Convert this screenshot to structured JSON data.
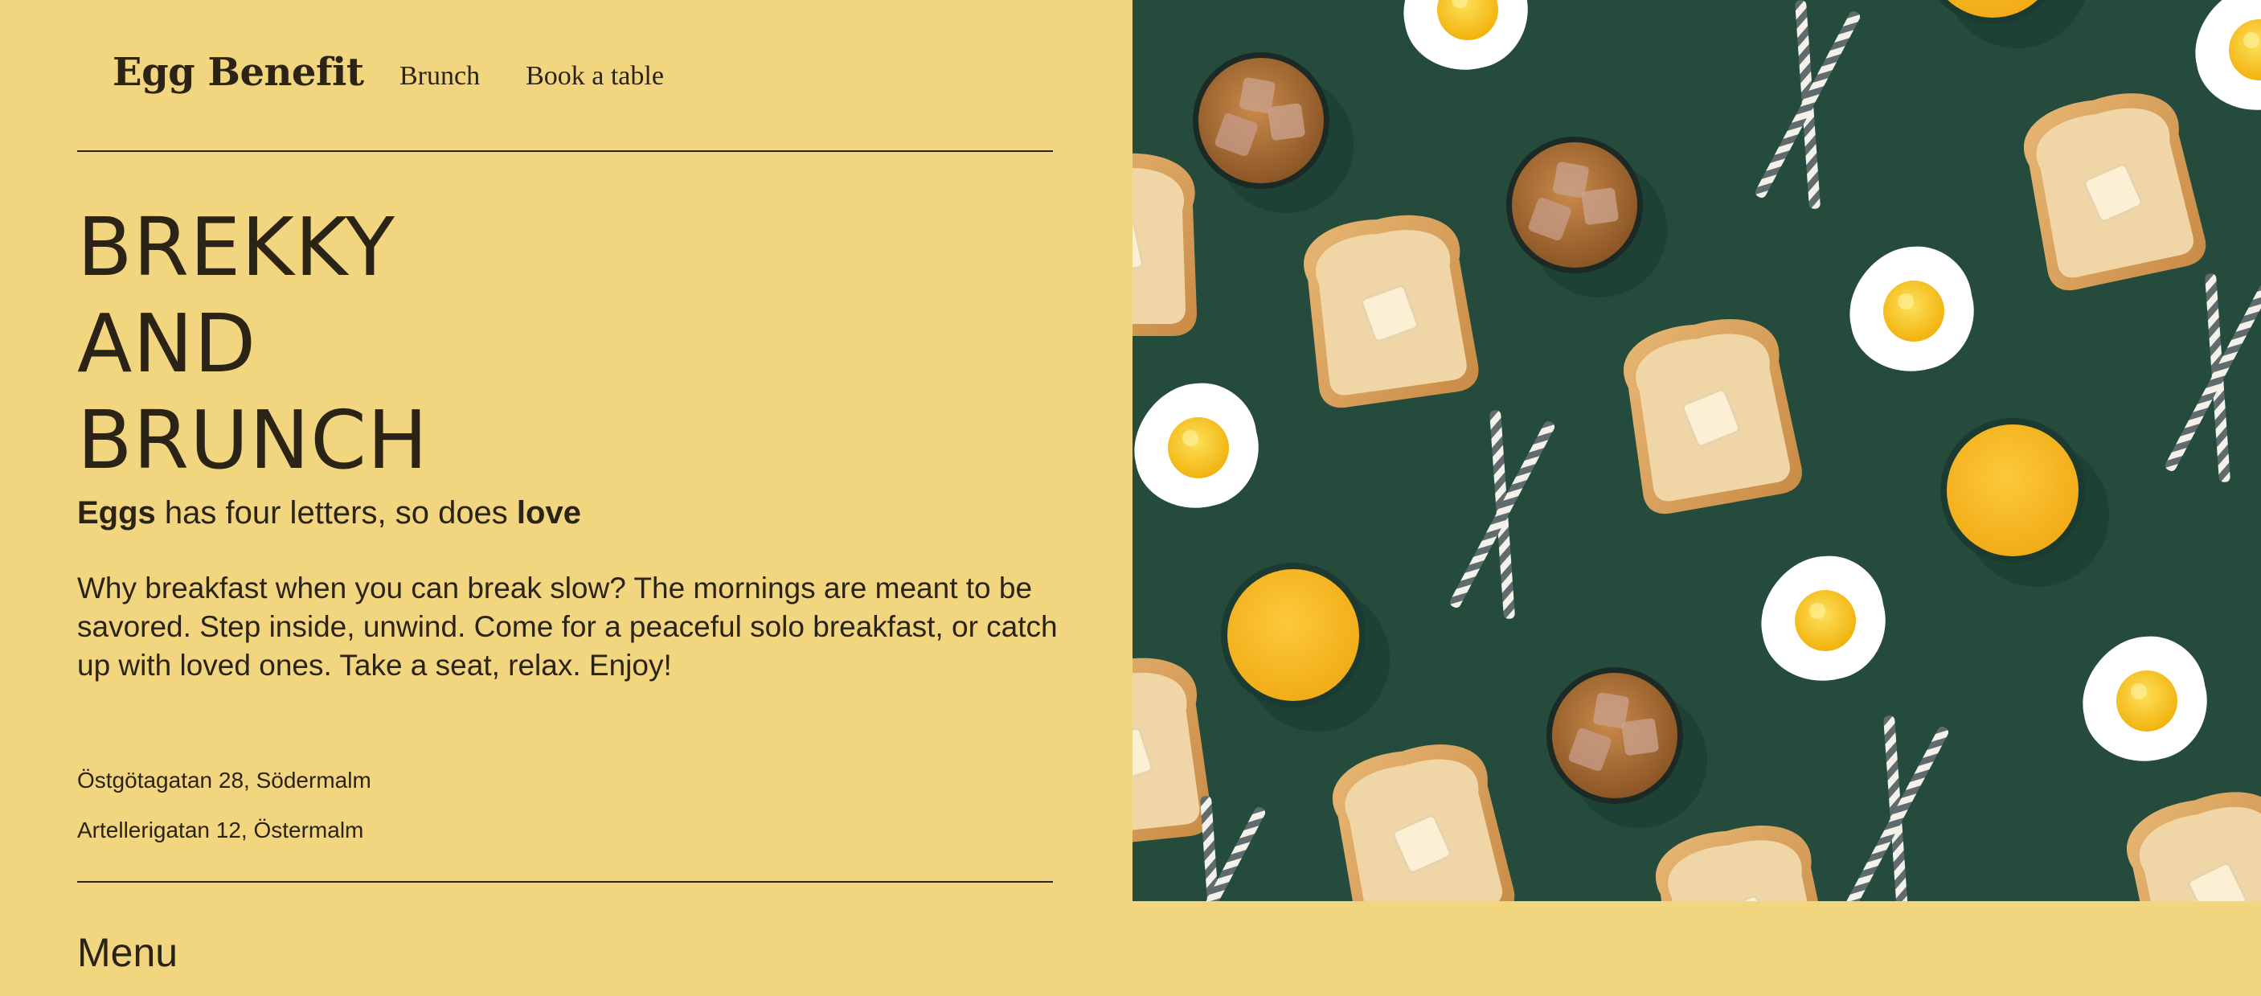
{
  "header": {
    "brand": "Egg Benefit",
    "nav": [
      "Brunch",
      "Book a table"
    ]
  },
  "hero": {
    "title_lines": [
      "BREKKY",
      "AND",
      "BRUNCH"
    ],
    "tagline": {
      "w1": "Eggs",
      "mid": " has four letters, so does ",
      "w2": "love"
    },
    "description": "Why breakfast when you can break slow? The mornings are meant to be savored. Step inside, unwind. Come for a peaceful solo breakfast, or catch up with loved ones. Take a seat, relax. Enjoy!"
  },
  "addresses": [
    "Östgötagatan 28, Södermalm",
    "Artellerigatan 12, Östermalm"
  ],
  "menu": {
    "heading": "Menu"
  },
  "photo": {
    "subject": "breakfast flat lay: toast with butter, fried eggs, iced coffee, orange juice and striped straws",
    "colors": {
      "background": "#254b3c",
      "page": "#f1d57f",
      "text": "#2b2416"
    }
  }
}
